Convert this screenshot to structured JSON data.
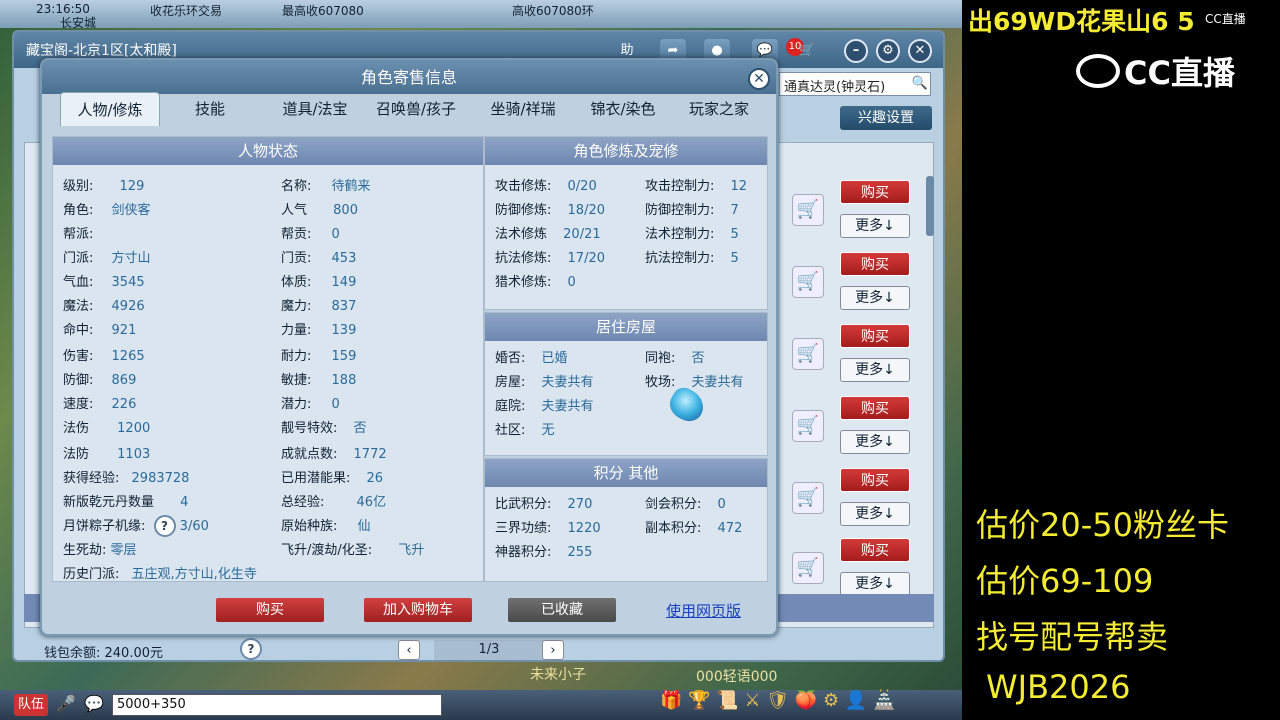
{
  "game_top": {
    "clock": "23:16:50",
    "strip_texts": [
      "收花乐环交易",
      "最高收607080",
      "高收607080环",
      "长安城"
    ]
  },
  "main_window": {
    "title": "藏宝阁-北京1区[太和殿]",
    "help_label": "助",
    "badge_count": "10",
    "search_value": "通真达灵(钟灵石)",
    "interest_button": "兴趣设置",
    "wallet_label": "钱包余额: 240.00元",
    "page_indicator": "1/3",
    "buy_label": "购买",
    "more_label": "更多↓"
  },
  "dialog": {
    "title": "角色寄售信息",
    "tabs": [
      {
        "label": "人物/修炼",
        "active": true
      },
      {
        "label": "技能"
      },
      {
        "label": "道具/法宝"
      },
      {
        "label": "召唤兽/孩子"
      },
      {
        "label": "坐骑/祥瑞"
      },
      {
        "label": "锦衣/染色"
      },
      {
        "label": "玩家之家"
      }
    ],
    "status": {
      "header": "人物状态",
      "left": [
        {
          "label": "级别:",
          "value": "129"
        },
        {
          "label": "角色:",
          "value": "剑侠客"
        },
        {
          "label": "帮派:",
          "value": ""
        },
        {
          "label": "门派:",
          "value": "方寸山"
        },
        {
          "label": "气血:",
          "value": "3545"
        },
        {
          "label": "魔法:",
          "value": "4926"
        },
        {
          "label": "命中:",
          "value": "921"
        },
        {
          "label": "伤害:",
          "value": "1265"
        },
        {
          "label": "防御:",
          "value": "869"
        },
        {
          "label": "速度:",
          "value": "226"
        },
        {
          "label": "法伤",
          "value": "1200"
        },
        {
          "label": "法防",
          "value": "1103"
        },
        {
          "label": "获得经验:",
          "value": "2983728"
        },
        {
          "label": "新版乾元丹数量",
          "value": "4"
        },
        {
          "label": "月饼粽子机缘:",
          "value": "3/60"
        },
        {
          "label": "生死劫:",
          "value": "零层"
        },
        {
          "label": "历史门派:",
          "value": "五庄观,方寸山,化生寺"
        }
      ],
      "right": [
        {
          "label": "名称:",
          "value": "待鹤来"
        },
        {
          "label": "人气",
          "value": "800"
        },
        {
          "label": "帮贡:",
          "value": "0"
        },
        {
          "label": "门贡:",
          "value": "453"
        },
        {
          "label": "体质:",
          "value": "149"
        },
        {
          "label": "魔力:",
          "value": "837"
        },
        {
          "label": "力量:",
          "value": "139"
        },
        {
          "label": "耐力:",
          "value": "159"
        },
        {
          "label": "敏捷:",
          "value": "188"
        },
        {
          "label": "潜力:",
          "value": "0"
        },
        {
          "label": "靓号特效:",
          "value": "否"
        },
        {
          "label": "成就点数:",
          "value": "1772"
        },
        {
          "label": "已用潜能果:",
          "value": "26"
        },
        {
          "label": "总经验:",
          "value": "46亿"
        },
        {
          "label": "原始种族:",
          "value": "仙"
        },
        {
          "label": "飞升/渡劫/化圣:",
          "value": "飞升"
        }
      ]
    },
    "cultivation": {
      "header": "角色修炼及宠修",
      "left": [
        {
          "label": "攻击修炼:",
          "value": "0/20"
        },
        {
          "label": "防御修炼:",
          "value": "18/20"
        },
        {
          "label": "法术修炼",
          "value": "20/21"
        },
        {
          "label": "抗法修炼:",
          "value": "17/20"
        },
        {
          "label": "猎术修炼:",
          "value": "0"
        }
      ],
      "right": [
        {
          "label": "攻击控制力:",
          "value": "12"
        },
        {
          "label": "防御控制力:",
          "value": "7"
        },
        {
          "label": "法术控制力:",
          "value": "5"
        },
        {
          "label": "抗法控制力:",
          "value": "5"
        }
      ]
    },
    "house": {
      "header": "居住房屋",
      "left": [
        {
          "label": "婚否:",
          "value": "已婚"
        },
        {
          "label": "房屋:",
          "value": "夫妻共有"
        },
        {
          "label": "庭院:",
          "value": "夫妻共有"
        },
        {
          "label": "社区:",
          "value": "无"
        }
      ],
      "right": [
        {
          "label": "同袍:",
          "value": "否"
        },
        {
          "label": "牧场:",
          "value": "夫妻共有"
        }
      ]
    },
    "points": {
      "header": "积分 其他",
      "left": [
        {
          "label": "比武积分:",
          "value": "270"
        },
        {
          "label": "三界功绩:",
          "value": "1220"
        },
        {
          "label": "神器积分:",
          "value": "255"
        }
      ],
      "right": [
        {
          "label": "剑会积分:",
          "value": "0"
        },
        {
          "label": "副本积分:",
          "value": "472"
        }
      ]
    },
    "buttons": {
      "buy": "购买",
      "add_cart": "加入购物车",
      "favorited": "已收藏",
      "web": "使用网页版"
    }
  },
  "chat": {
    "team": "队伍",
    "input_value": "5000+350",
    "names": [
      "未来小子",
      "000轻语000"
    ]
  },
  "stream_side": {
    "title": "出69WD花果山6 5",
    "brand": "CC直播",
    "lines": [
      "估价20-50粉丝卡",
      "估价69-109",
      "找号配号帮卖",
      "WJB2026"
    ]
  }
}
